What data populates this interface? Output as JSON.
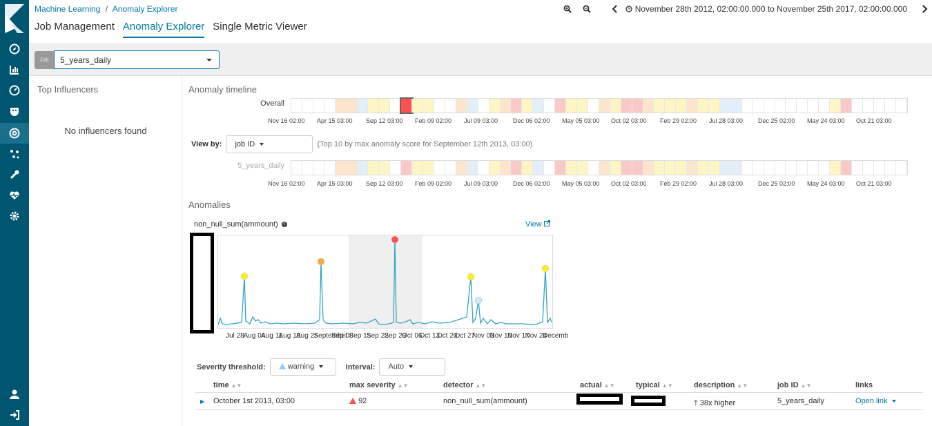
{
  "breadcrumb": {
    "root": "Machine Learning",
    "separator": "/",
    "current": "Anomaly Explorer"
  },
  "tabs": [
    {
      "label": "Job Management",
      "active": false
    },
    {
      "label": "Anomaly Explorer",
      "active": true
    },
    {
      "label": "Single Metric Viewer",
      "active": false
    }
  ],
  "time_range": {
    "label": "November 28th 2012, 02:00:00.000 to November 25th 2017, 02:00:00.000"
  },
  "job": {
    "tag": "Job",
    "selected": "5_years_daily"
  },
  "influencers": {
    "title": "Top Influencers",
    "empty": "No influencers found"
  },
  "timeline": {
    "title": "Anomaly timeline",
    "overall_label": "Overall",
    "job_lane_label": "5_years_daily",
    "tick_labels": [
      "Nov 16 02:00",
      "Apr 15 03:00",
      "Sep 12 03:00",
      "Feb 09 02:00",
      "Jul 09 03:00",
      "Dec 06 02:00",
      "May 05 03:00",
      "Oct 02 03:00",
      "Feb 29 02:00",
      "Jul 28 03:00",
      "Dec 25 02:00",
      "May 24 03:00",
      "Oct 21 03:00"
    ],
    "view_by_label": "View by:",
    "view_by_value": "job ID",
    "view_by_note": "(Top 10 by max anomaly score for September 12th 2013, 03:00)"
  },
  "anomalies": {
    "title": "Anomalies",
    "chart_label": "non_null_sum(ammount)",
    "view_link": "View",
    "x_tick_labels": [
      "Jul 28",
      "Aug 04",
      "Aug 11",
      "Aug 18",
      "Aug 25",
      "September",
      "Sep 08",
      "Sep 15",
      "Sep 22",
      "Sep 29",
      "Oct 06",
      "Oct 13",
      "Oct 20",
      "Oct 27",
      "Nov 03",
      "Nov 10",
      "Nov 17",
      "Nov 24",
      "Decemb"
    ]
  },
  "filters": {
    "severity_label": "Severity threshold:",
    "severity_value": "warning",
    "interval_label": "Interval:",
    "interval_value": "Auto"
  },
  "table": {
    "headers": {
      "time": "time",
      "max_severity": "max severity",
      "detector": "detector",
      "actual": "actual",
      "typical": "typical",
      "description": "description",
      "job_id": "job ID",
      "links": "links"
    },
    "rows": [
      {
        "time": "October 1st 2013, 03:00",
        "max_severity": "92",
        "detector": "non_null_sum(ammount)",
        "description": "38x higher",
        "job_id": "5_years_daily",
        "links": "Open link"
      }
    ]
  },
  "colors": {
    "sidebar": "#005571",
    "accent": "#0079a5",
    "critical": "#fe5050",
    "major": "#fba740",
    "minor": "#fdec25",
    "warning_low": "#8bc8fb"
  }
}
